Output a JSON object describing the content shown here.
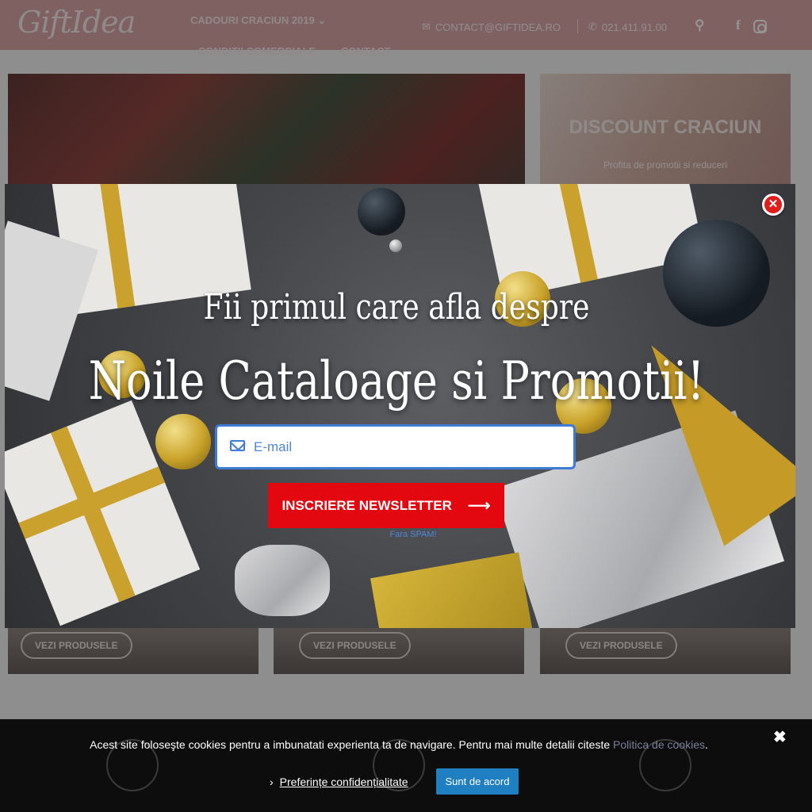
{
  "header": {
    "logo": "GiftIdea",
    "nav": [
      "CADOURI CRACIUN 2019",
      "CONDITII COMERCIALE",
      "CONTACT"
    ],
    "nav_dropdown_icon": "chevron-down-icon",
    "email": "CONTACT@GIFTIDEA.RO",
    "phone": "021.411.91.00",
    "icons": [
      "search-icon",
      "facebook-icon",
      "instagram-icon"
    ]
  },
  "banner_side": {
    "title": "DISCOUNT CRACIUN",
    "subtitle": "Profita de promotii si reduceri"
  },
  "cards": [
    {
      "button": "VEZI PRODUSELE"
    },
    {
      "button": "VEZI PRODUSELE"
    },
    {
      "button": "VEZI PRODUSELE"
    }
  ],
  "popup": {
    "headline_line1": "Fii primul care afla despre",
    "headline_line2": "Noile Cataloage si Promotii!",
    "email_placeholder": "E-mail",
    "email_value": "",
    "subscribe_label": "INSCRIERE NEWSLETTER",
    "nospam": "Fara SPAM!",
    "colors": {
      "accent": "#e3080f",
      "input_border": "#3d7bd6"
    }
  },
  "cookie_bar": {
    "text": "Acest site foloseşte cookies pentru a imbunatati experienta ta de navigare. Pentru mai multe detalii citeste",
    "link": "Politica de cookies",
    "trailing": ".",
    "preferences": "Preferințe confidențialitate",
    "agree": "Sunt de acord",
    "close_glyph": "✖",
    "colors": {
      "agree_button": "#1f7fc0"
    }
  }
}
